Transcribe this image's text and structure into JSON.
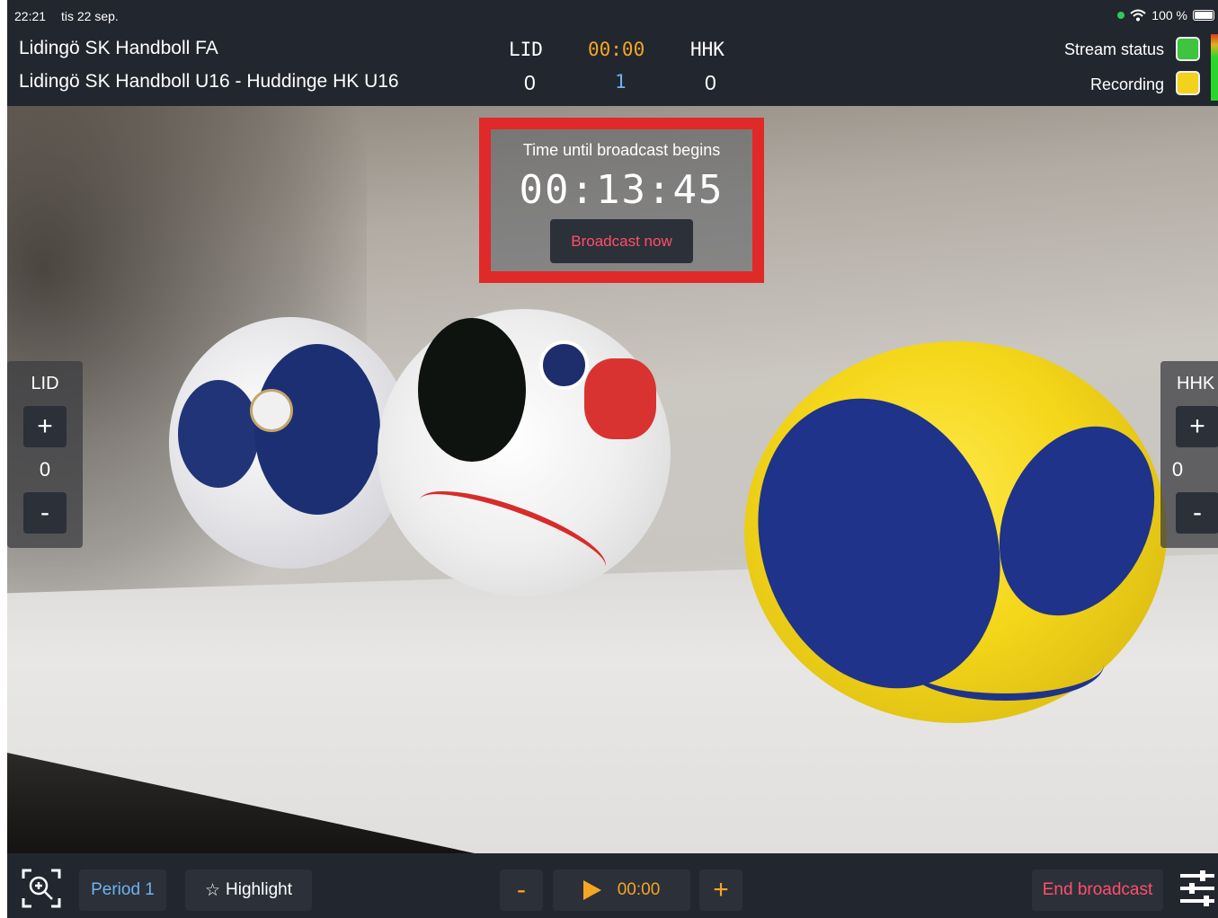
{
  "status_bar": {
    "time": "22:21",
    "date": "tis 22 sep.",
    "battery": "100 %",
    "icons": [
      "green-dot-icon",
      "wifi-icon",
      "battery-icon"
    ]
  },
  "header": {
    "club": "Lidingö SK Handboll FA",
    "match": "Lidingö SK Handboll U16 - Huddinge HK U16",
    "home_abbr": "LID",
    "away_abbr": "HHK",
    "clock": "00:00",
    "home_score": "0",
    "away_score": "0",
    "period": "1",
    "stream_status_label": "Stream status",
    "recording_label": "Recording",
    "colors": {
      "stream_ok": "#3ec43e",
      "recording": "#f2d21c",
      "clock": "#f5a623",
      "period": "#6db3f2"
    }
  },
  "countdown": {
    "label": "Time until broadcast begins",
    "value": "00:13:45",
    "button": "Broadcast now",
    "highlight_color": "#e02929"
  },
  "left_panel": {
    "team": "LID",
    "plus": "+",
    "score": "0",
    "minus": "-"
  },
  "right_panel": {
    "team": "HHK",
    "plus": "+",
    "score": "0",
    "minus": "-"
  },
  "bottom_bar": {
    "zoom_icon": "zoom-in-icon",
    "period_button": "Period 1",
    "highlight_star": "☆",
    "highlight_button": "Highlight",
    "clock_minus": "-",
    "clock_value": "00:00",
    "clock_plus": "+",
    "end_button": "End broadcast",
    "settings_icon": "sliders-icon",
    "colors": {
      "end": "#ff4f6a",
      "accent": "#f5a623"
    }
  }
}
